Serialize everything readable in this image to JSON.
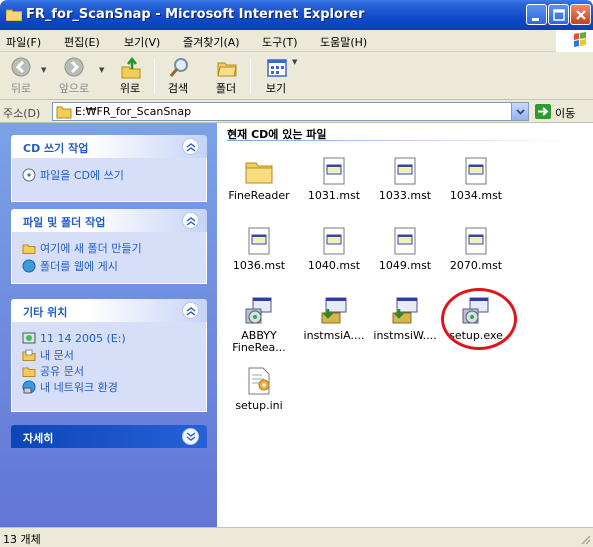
{
  "window": {
    "title": "FR_for_ScanSnap - Microsoft Internet Explorer"
  },
  "menu": [
    "파일(F)",
    "편집(E)",
    "보기(V)",
    "즐겨찾기(A)",
    "도구(T)",
    "도움말(H)"
  ],
  "toolbar": {
    "back": "뒤로",
    "forward": "앞으로",
    "up": "위로",
    "search": "검색",
    "folders": "폴더",
    "views": "보기"
  },
  "address": {
    "label": "주소(D)",
    "value": "E:₩FR_for_ScanSnap",
    "go": "이동"
  },
  "leftpane": {
    "panels": [
      {
        "title": "CD 쓰기 작업",
        "tasks": [
          "파일을 CD에 쓰기"
        ]
      },
      {
        "title": "파일 및 폴더 작업",
        "tasks": [
          "여기에 새 폴더 만들기",
          "폴더를 웹에 게시"
        ]
      },
      {
        "title": "기타 위치",
        "tasks": [
          "11 14 2005 (E:)",
          "내 문서",
          "공유 문서",
          "내 네트워크 환경"
        ]
      },
      {
        "title": "자세히",
        "tasks": []
      }
    ]
  },
  "content": {
    "group_title": "현재 CD에 있는 파일",
    "files": [
      {
        "name": "FineReader",
        "type": "folder"
      },
      {
        "name": "1031.mst",
        "type": "mst"
      },
      {
        "name": "1033.mst",
        "type": "mst"
      },
      {
        "name": "1034.mst",
        "type": "mst"
      },
      {
        "name": "1036.mst",
        "type": "mst"
      },
      {
        "name": "1040.mst",
        "type": "mst"
      },
      {
        "name": "1049.mst",
        "type": "mst"
      },
      {
        "name": "2070.mst",
        "type": "mst"
      },
      {
        "name": "ABBYY",
        "name2": "FineRea...",
        "type": "installer"
      },
      {
        "name": "instmsiA....",
        "type": "exe"
      },
      {
        "name": "instmsiW....",
        "type": "exe"
      },
      {
        "name": "setup.exe",
        "type": "installer"
      },
      {
        "name": "setup.ini",
        "type": "ini"
      }
    ]
  },
  "status": {
    "text": "13 개체"
  },
  "colors": {
    "title_bar": "#0f4ac9",
    "task_pane": "#6f8fdf",
    "highlight_circle": "#e0141b"
  }
}
